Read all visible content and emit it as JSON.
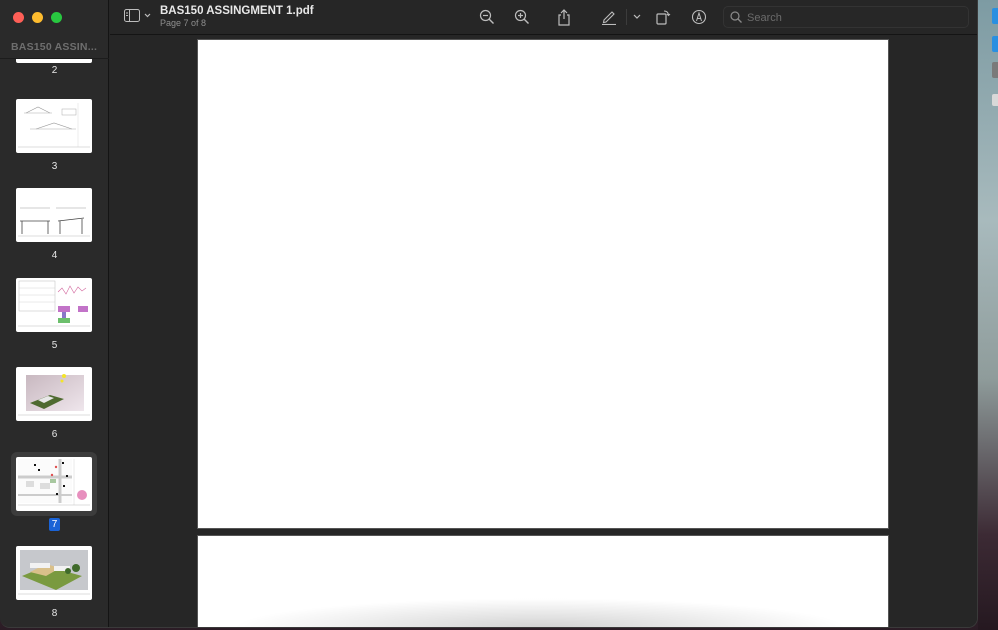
{
  "window": {
    "title": "BAS150 ASSINGMENT 1.pdf",
    "subtitle": "Page 7 of 8"
  },
  "sidebar": {
    "title": "BAS150 ASSIN...",
    "thumbnails": [
      {
        "page": "2",
        "selected": false,
        "content": "drawing-sheet"
      },
      {
        "page": "3",
        "selected": false,
        "content": "elevations"
      },
      {
        "page": "4",
        "selected": false,
        "content": "sections"
      },
      {
        "page": "5",
        "selected": false,
        "content": "tables-and-charts"
      },
      {
        "page": "6",
        "selected": false,
        "content": "sun-study-render"
      },
      {
        "page": "7",
        "selected": true,
        "content": "site-plan"
      },
      {
        "page": "8",
        "selected": false,
        "content": "3d-render"
      }
    ]
  },
  "toolbar": {
    "icons": [
      "sidebar-toggle-icon",
      "zoom-out-icon",
      "zoom-in-icon",
      "share-icon",
      "markup-pen-icon",
      "markup-dropdown-icon",
      "rotate-icon",
      "annotate-icon"
    ],
    "search_placeholder": "Search"
  },
  "colors": {
    "accent": "#1a63d6",
    "window_bg": "#262626",
    "close": "#fe5f57",
    "minimize": "#febc2e",
    "maximize": "#28c840"
  }
}
